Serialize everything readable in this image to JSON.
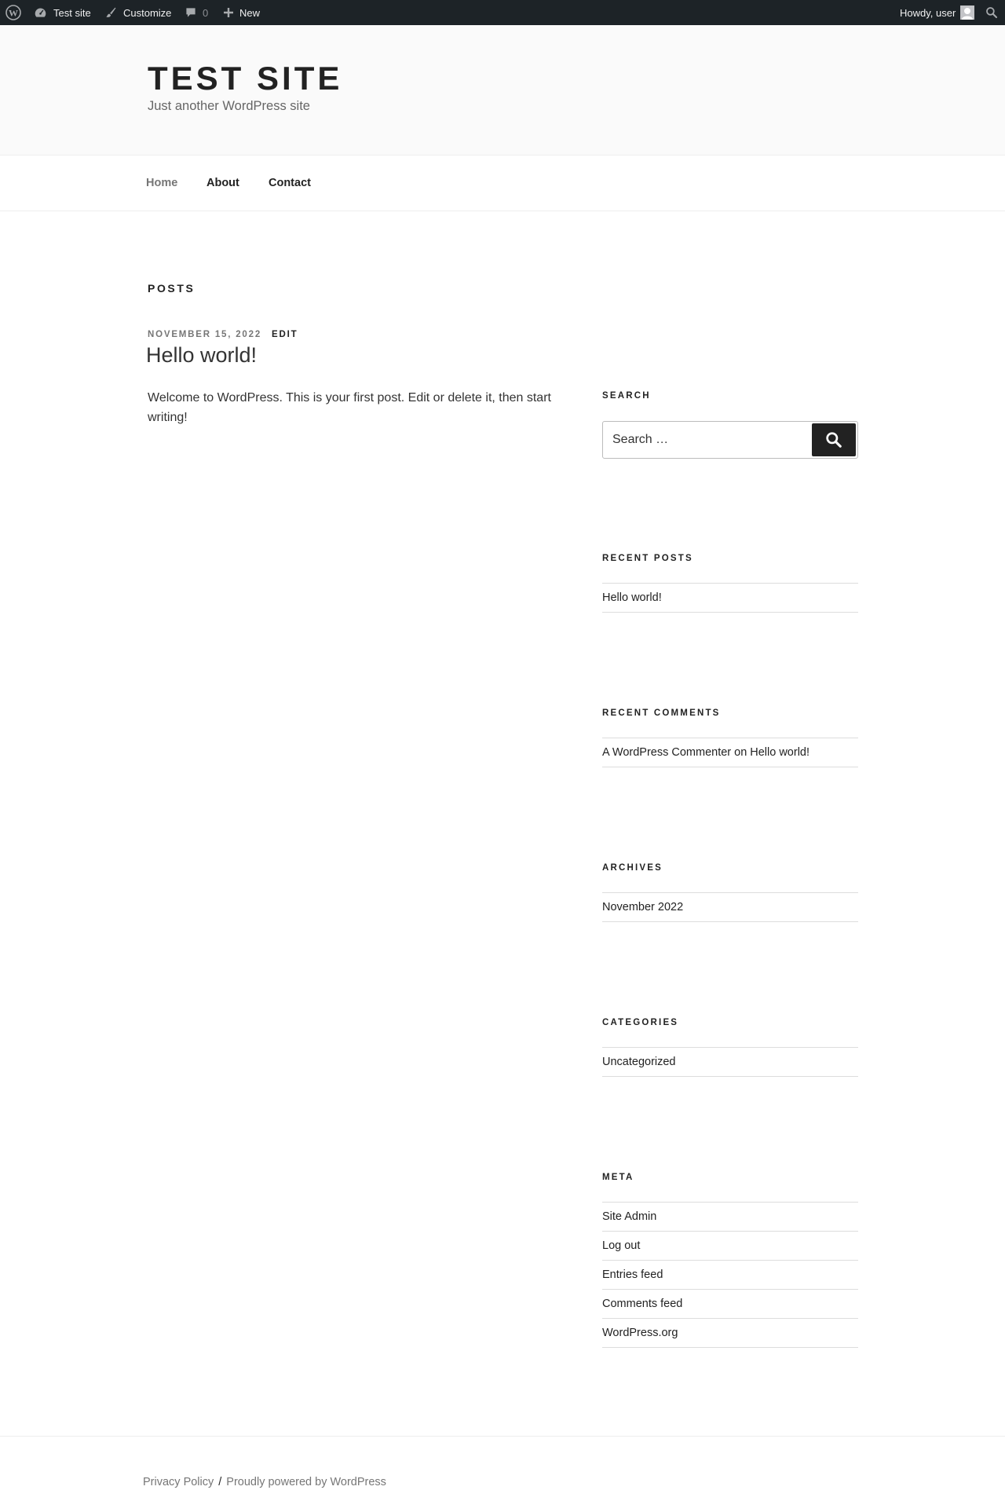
{
  "adminbar": {
    "site_name": "Test site",
    "customize": "Customize",
    "comments_count": "0",
    "new_label": "New",
    "howdy": "Howdy, user"
  },
  "header": {
    "title": "TEST SITE",
    "description": "Just another WordPress site"
  },
  "nav": {
    "items": [
      {
        "label": "Home"
      },
      {
        "label": "About"
      },
      {
        "label": "Contact"
      }
    ]
  },
  "main": {
    "page_title": "POSTS",
    "post": {
      "date": "NOVEMBER 15, 2022",
      "edit": "EDIT",
      "title": "Hello world!",
      "content": "Welcome to WordPress. This is your first post. Edit or delete it, then start writing!"
    }
  },
  "sidebar": {
    "search": {
      "title": "SEARCH",
      "placeholder": "Search …"
    },
    "recent_posts": {
      "title": "RECENT POSTS",
      "items": [
        "Hello world!"
      ]
    },
    "recent_comments": {
      "title": "RECENT COMMENTS",
      "author": "A WordPress Commenter",
      "on": "on",
      "post": "Hello world!"
    },
    "archives": {
      "title": "ARCHIVES",
      "items": [
        "November 2022"
      ]
    },
    "categories": {
      "title": "CATEGORIES",
      "items": [
        "Uncategorized"
      ]
    },
    "meta": {
      "title": "META",
      "items": [
        "Site Admin",
        "Log out",
        "Entries feed",
        "Comments feed",
        "WordPress.org"
      ]
    }
  },
  "footer": {
    "privacy": "Privacy Policy",
    "separator": "/",
    "powered": "Proudly powered by WordPress"
  }
}
